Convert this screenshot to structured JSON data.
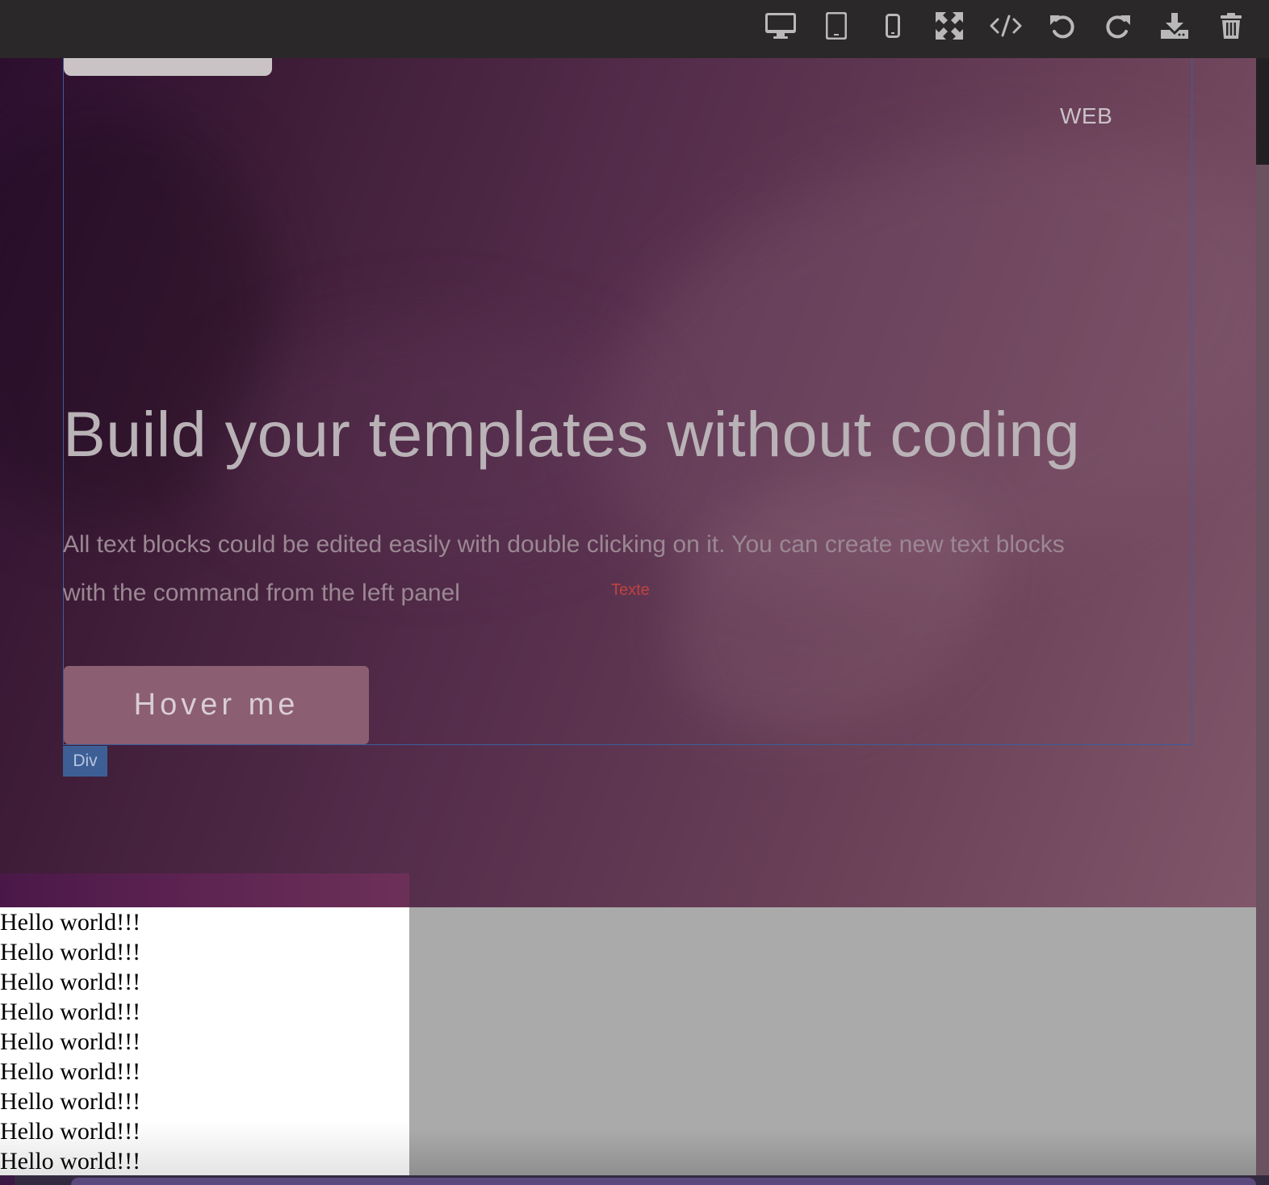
{
  "toolbar": {
    "buttons": [
      {
        "icon": "desktop-icon",
        "label": "Desktop view"
      },
      {
        "icon": "tablet-icon",
        "label": "Tablet view"
      },
      {
        "icon": "mobile-icon",
        "label": "Mobile view"
      },
      {
        "icon": "fullscreen-icon",
        "label": "Fullscreen"
      },
      {
        "icon": "code-icon",
        "label": "View code"
      },
      {
        "icon": "undo-icon",
        "label": "Undo"
      },
      {
        "icon": "redo-icon",
        "label": "Redo"
      },
      {
        "icon": "download-icon",
        "label": "Export"
      },
      {
        "icon": "trash-icon",
        "label": "Clear canvas"
      }
    ],
    "icon_color": "#b9b9b9"
  },
  "hero": {
    "nav_link": "WEB",
    "title": "Build your templates without coding",
    "text": "All text blocks could be edited easily with double clicking on it. You can create new text blocks with the command from the left panel",
    "texte_label": "Texte",
    "button_label": "Hover me"
  },
  "selection": {
    "badge": "Div",
    "frame_color": "#3b5e9c"
  },
  "content": {
    "lines": [
      "Hello world!!!",
      "Hello world!!!",
      "Hello world!!!",
      "Hello world!!!",
      "Hello world!!!",
      "Hello world!!!",
      "Hello world!!!",
      "Hello world!!!",
      "Hello world!!!"
    ]
  },
  "colors": {
    "toolbar_bg": "#2b2829",
    "button_bg": "#8c5e72",
    "gray_panel": "#aaaaaa"
  }
}
